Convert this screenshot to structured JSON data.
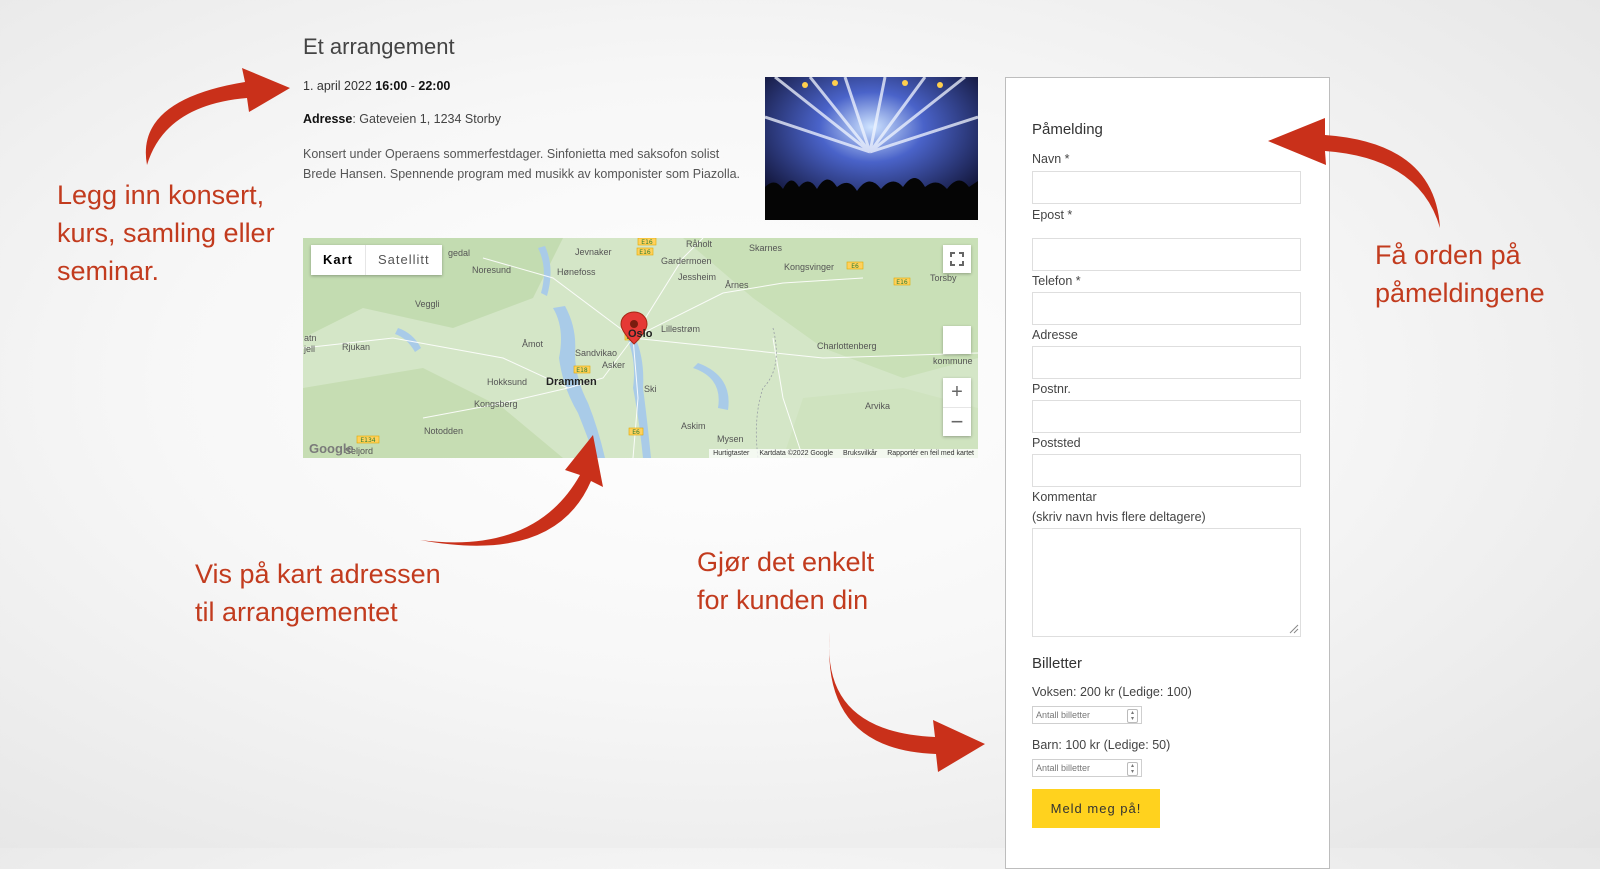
{
  "event": {
    "title": "Et arrangement",
    "date": "1. april 2022",
    "time_start": "16:00",
    "time_sep": " - ",
    "time_end": "22:00",
    "address_label": "Adresse",
    "address_value": ": Gateveien 1, 1234 Storby",
    "description": "Konsert under Operaens sommerfestdager. Sinfonietta med saksofon solist Brede Hansen. Spennende program med musikk av komponister som Piazolla."
  },
  "map": {
    "type_map": "Kart",
    "type_satellite": "Satellitt",
    "places": [
      "Jevnaker",
      "Råholt",
      "Skarnes",
      "Gardermoen",
      "Noresund",
      "Hønefoss",
      "Jessheim",
      "Kongsvinger",
      "Torsby",
      "Årnes",
      "Veggli",
      "Lillestrøm",
      "Oslo",
      "Charlottenberg",
      "Åmot",
      "Sandvikao",
      "Rjukan",
      "Asker",
      "Hokksund",
      "Drammen",
      "Ski",
      "Kongsberg",
      "Arvika",
      "Notodden",
      "Askim",
      "Mysen",
      "Seljord",
      "atn",
      "jell",
      "kommune",
      "gedal"
    ],
    "footer": [
      "Hurtigtaster",
      "Kartdata ©2022 Google",
      "Bruksvilkår",
      "Rapportér en feil med kartet"
    ],
    "google_logo": "Google",
    "road_labels": [
      "E16",
      "E16",
      "E6",
      "E16",
      "E18",
      "E134",
      "E6",
      "E18"
    ]
  },
  "form": {
    "heading": "Påmelding",
    "fields": {
      "name": "Navn *",
      "email": "Epost *",
      "phone": "Telefon *",
      "address": "Adresse",
      "postnr": "Postnr.",
      "poststed": "Poststed",
      "comment": "Kommentar",
      "comment_hint": "(skriv navn hvis flere deltagere)"
    },
    "tickets_heading": "Billetter",
    "tickets": [
      {
        "label": "Voksen: 200 kr (Ledige: 100)",
        "placeholder": "Antall billetter"
      },
      {
        "label": "Barn: 100 kr (Ledige: 50)",
        "placeholder": "Antall billetter"
      }
    ],
    "submit": "Meld meg på!"
  },
  "callouts": {
    "left": [
      "Legg inn konsert,",
      "kurs, samling eller",
      "seminar."
    ],
    "right": [
      "Få orden på",
      "påmeldingene"
    ],
    "map": [
      "Vis på kart adressen",
      "til arrangementet"
    ],
    "middle": [
      "Gjør det enkelt",
      "for kunden din"
    ]
  },
  "colors": {
    "callout_text": "#c23b1e",
    "arrow": "#c9301a",
    "button": "#ffd21e",
    "marker": "#e53935"
  }
}
